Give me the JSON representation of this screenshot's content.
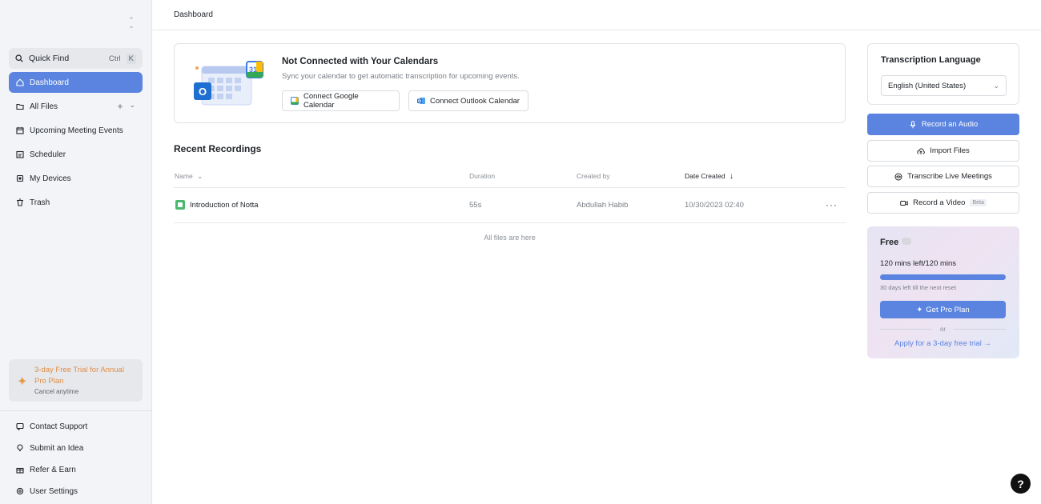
{
  "sidebar": {
    "quick_find": {
      "label": "Quick Find",
      "shortcut_mod": "Ctrl",
      "shortcut_key": "K"
    },
    "items": [
      {
        "label": "Dashboard",
        "icon": "home-icon",
        "active": true
      },
      {
        "label": "All Files",
        "icon": "folder-icon"
      },
      {
        "label": "Upcoming Meeting Events",
        "icon": "calendar-icon"
      },
      {
        "label": "Scheduler",
        "icon": "scheduler-icon"
      },
      {
        "label": "My Devices",
        "icon": "device-icon"
      },
      {
        "label": "Trash",
        "icon": "trash-icon"
      }
    ],
    "trial": {
      "title": "3-day Free Trial for Annual Pro Plan",
      "subtitle": "Cancel anytime"
    },
    "footer": [
      {
        "label": "Contact Support",
        "icon": "support-icon"
      },
      {
        "label": "Submit an Idea",
        "icon": "lightbulb-icon"
      },
      {
        "label": "Refer & Earn",
        "icon": "gift-icon"
      },
      {
        "label": "User Settings",
        "icon": "settings-icon"
      }
    ]
  },
  "header": {
    "title": "Dashboard"
  },
  "calendar": {
    "title": "Not Connected with Your Calendars",
    "subtitle": "Sync your calendar to get automatic transcription for upcoming events.",
    "google_label": "Connect Google Calendar",
    "outlook_label": "Connect Outlook Calendar",
    "illustration_day": "31"
  },
  "recordings": {
    "title": "Recent Recordings",
    "columns": {
      "name": "Name",
      "duration": "Duration",
      "created_by": "Created by",
      "date": "Date Created"
    },
    "rows": [
      {
        "name": "Introduction of Notta",
        "duration": "55s",
        "created_by": "Abdullah Habib",
        "date": "10/30/2023 02:40"
      }
    ],
    "empty_text": "All files are here"
  },
  "right": {
    "language": {
      "title": "Transcription Language",
      "value": "English (United States)"
    },
    "actions": {
      "record_audio": "Record an Audio",
      "import_files": "Import Files",
      "transcribe_live": "Transcribe Live Meetings",
      "record_video": "Record a Video",
      "beta": "Beta"
    },
    "plan": {
      "name": "Free",
      "minutes": "120 mins left/120 mins",
      "usage_fraction": 1.0,
      "reset_text": "30 days left till the next reset",
      "pro_button": "Get Pro Plan",
      "or": "or",
      "apply_link": "Apply for a 3-day free trial →"
    }
  },
  "help": {
    "label": "?"
  },
  "colors": {
    "accent": "#5b84e0",
    "trial_text": "#e08d45",
    "file_green": "#4cb86e"
  }
}
